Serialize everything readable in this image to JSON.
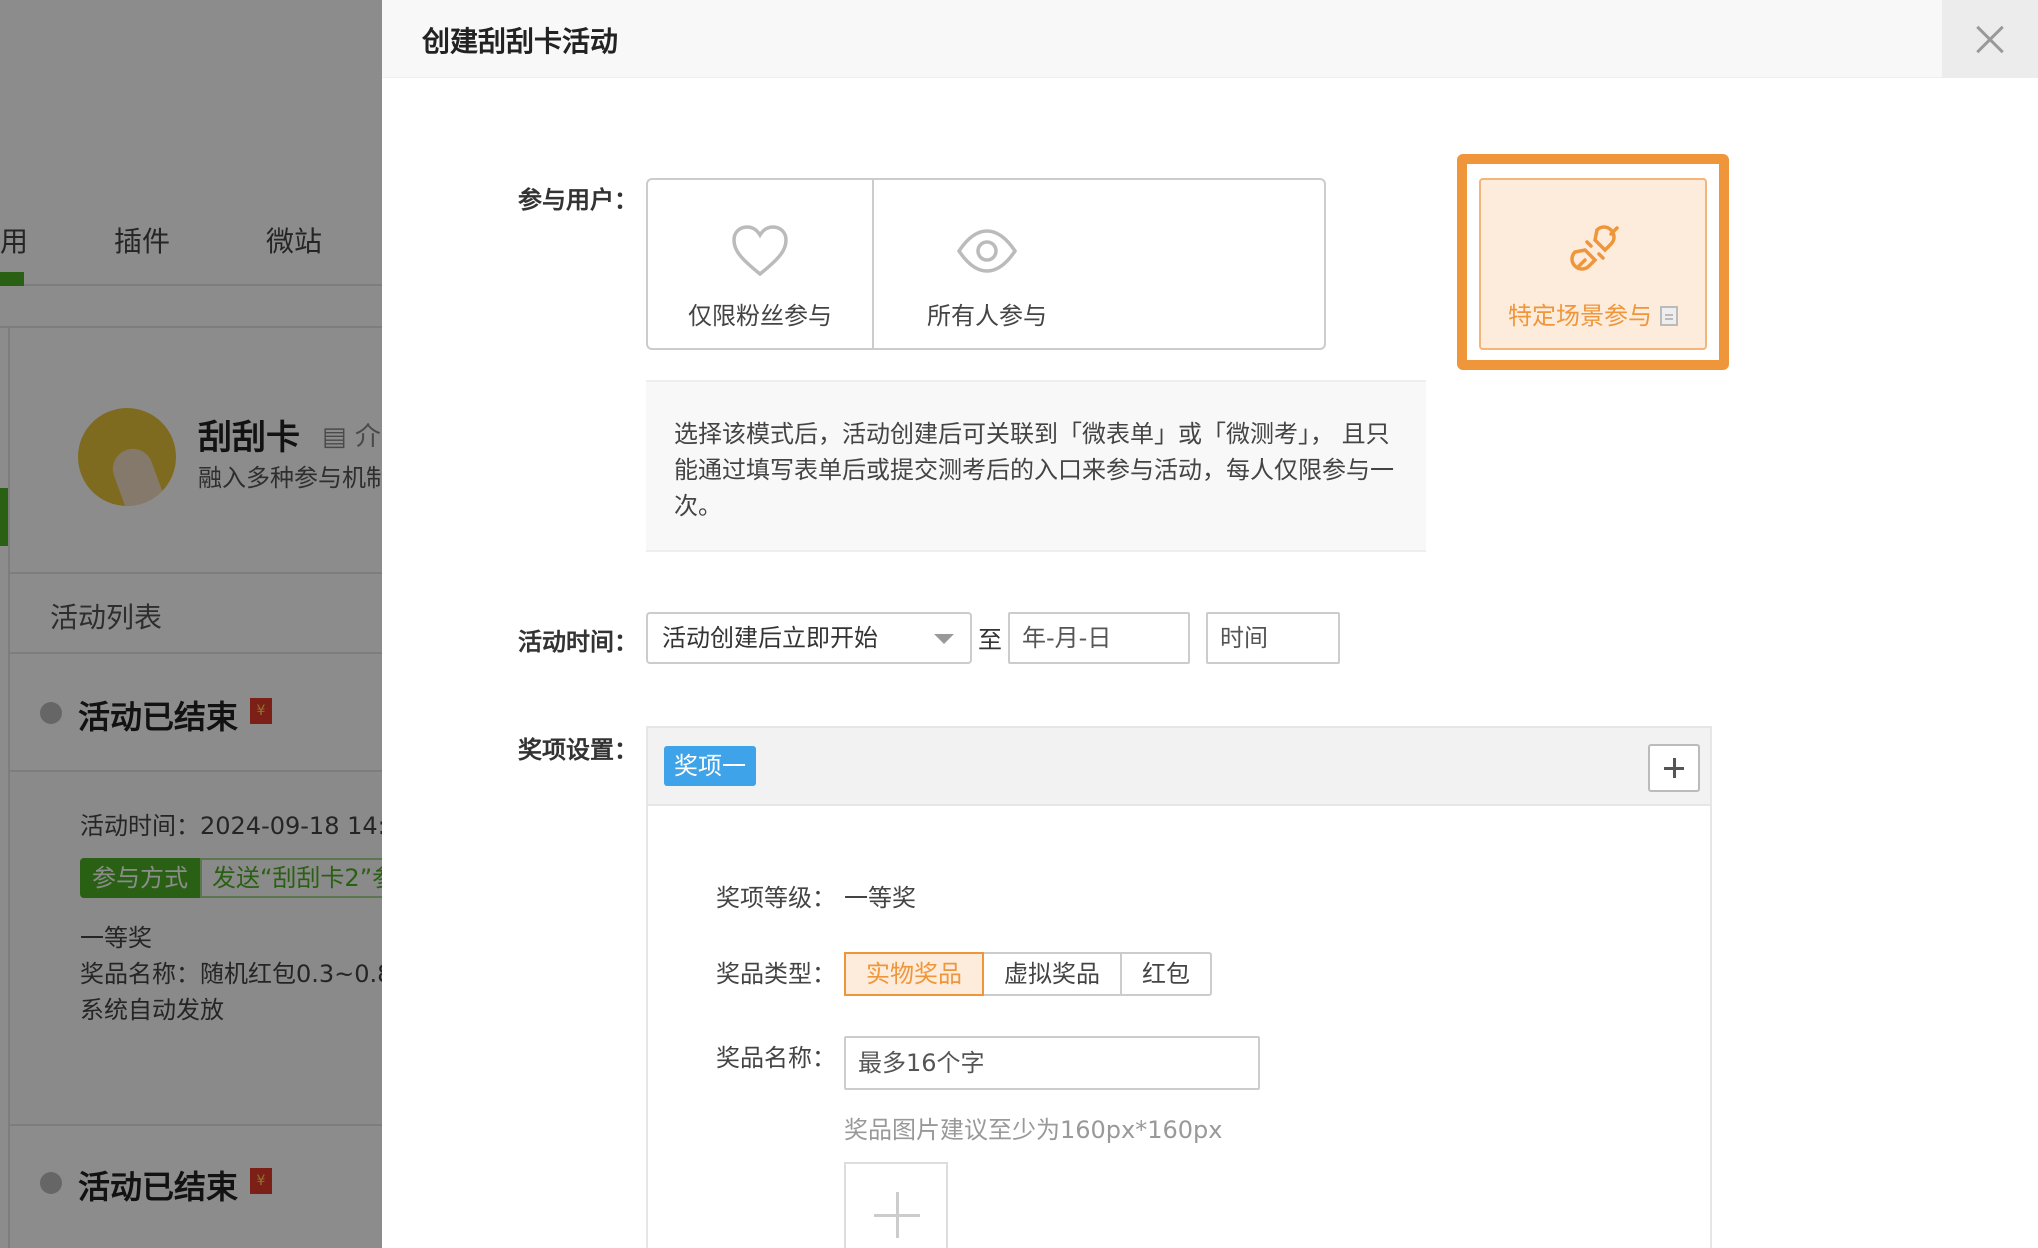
{
  "background": {
    "tabs": [
      {
        "label": "用"
      },
      {
        "label": "插件"
      },
      {
        "label": "微站"
      }
    ],
    "app": {
      "name": "刮刮卡",
      "intro": "▤ 介",
      "desc": "融入多种参与机制"
    },
    "list_title": "活动列表",
    "activities": [
      {
        "status": "活动已结束",
        "time_label": "活动时间：2024-09-18 14:",
        "join_label": "参与方式",
        "join_value": "发送“刮刮卡2”参",
        "prize_level": "一等奖",
        "prize_name": "奖品名称：随机红包0.3~0.8",
        "prize_send": "系统自动发放"
      },
      {
        "status": "活动已结束"
      }
    ],
    "redpack_glyph": "¥"
  },
  "modal": {
    "title": "创建刮刮卡活动",
    "participants": {
      "label": "参与用户：",
      "options": [
        {
          "label": "仅限粉丝参与",
          "icon": "heart-icon"
        },
        {
          "label": "所有人参与",
          "icon": "eye-icon"
        },
        {
          "label": "特定场景参与",
          "icon": "plug-icon",
          "selected": true
        }
      ],
      "description": "选择该模式后，活动创建后可关联到「微表单」或「微测考」， 且只能通过填写表单后或提交测考后的入口来参与活动，每人仅限参与一次。"
    },
    "activity_time": {
      "label": "活动时间：",
      "start_option": "活动创建后立即开始",
      "to": "至",
      "date_placeholder": "年-月-日",
      "time_placeholder": "时间"
    },
    "prizes": {
      "label": "奖项设置：",
      "tab": "奖项一",
      "level_label": "奖项等级：",
      "level_value": "一等奖",
      "type_label": "奖品类型：",
      "types": [
        "实物奖品",
        "虚拟奖品",
        "红包"
      ],
      "name_label": "奖品名称：",
      "name_placeholder": "最多16个字",
      "image_hint": "奖品图片建议至少为160px*160px"
    }
  },
  "colors": {
    "accent": "#f0963a",
    "green": "#4caf24",
    "blue": "#3ea3e8"
  }
}
